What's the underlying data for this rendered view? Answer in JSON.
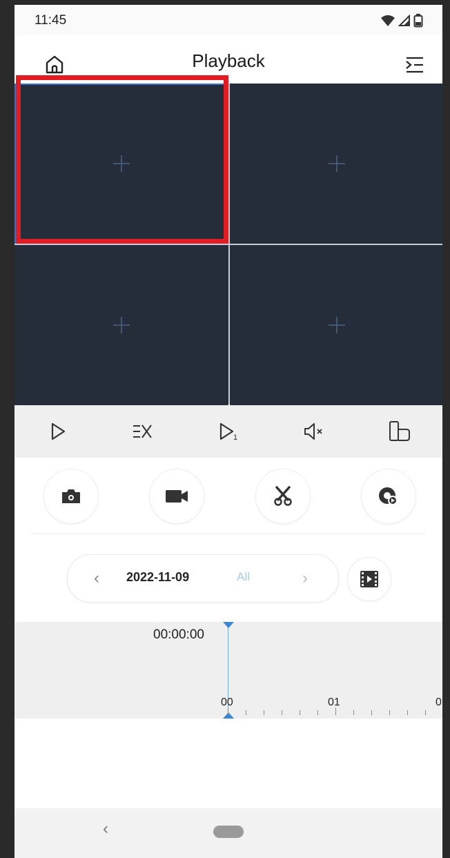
{
  "status_bar": {
    "time": "11:45",
    "icons": [
      "wifi-icon",
      "signal-icon",
      "battery-icon"
    ]
  },
  "header": {
    "title": "Playback",
    "left_icon": "home-icon",
    "right_icon": "device-list-icon"
  },
  "video_grid": {
    "cells": [
      {
        "icon": "add-icon",
        "selected": true
      },
      {
        "icon": "add-icon",
        "selected": false
      },
      {
        "icon": "add-icon",
        "selected": false
      },
      {
        "icon": "add-icon",
        "selected": false
      }
    ],
    "highlight_color": "#e01c24"
  },
  "control_bar": {
    "buttons": [
      "play-icon",
      "stop-all-icon",
      "single-frame-icon",
      "mute-icon",
      "rotate-screen-icon"
    ],
    "frame_label": "1"
  },
  "actions": {
    "buttons": [
      "snapshot-icon",
      "record-icon",
      "clip-icon",
      "playback-mode-icon"
    ]
  },
  "date_selector": {
    "prev_symbol": "‹",
    "date": "2022-11-09",
    "filter": "All",
    "next_symbol": "›",
    "video_list_icon": "film-icon"
  },
  "timeline": {
    "current_time": "00:00:00",
    "hour_labels": [
      "00",
      "01",
      "0"
    ]
  },
  "nav_bar": {
    "back_symbol": "‹"
  },
  "colors": {
    "video_bg": "#252d3b",
    "accent": "#3b86d6",
    "filter_text": "#a9c8ea"
  }
}
